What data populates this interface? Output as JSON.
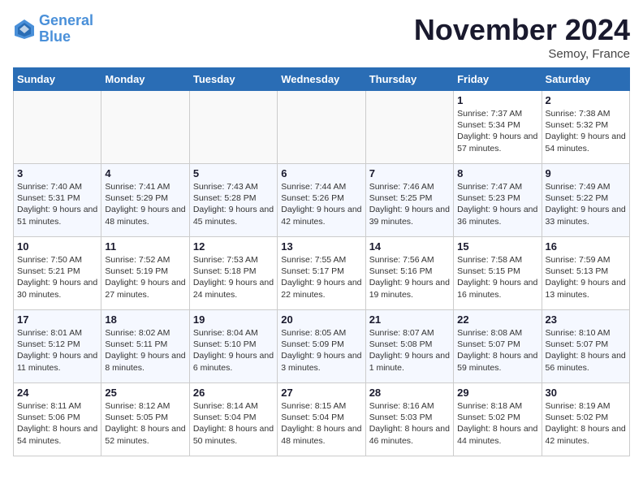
{
  "logo": {
    "line1": "General",
    "line2": "Blue"
  },
  "title": "November 2024",
  "location": "Semoy, France",
  "days_header": [
    "Sunday",
    "Monday",
    "Tuesday",
    "Wednesday",
    "Thursday",
    "Friday",
    "Saturday"
  ],
  "weeks": [
    [
      {
        "num": "",
        "info": ""
      },
      {
        "num": "",
        "info": ""
      },
      {
        "num": "",
        "info": ""
      },
      {
        "num": "",
        "info": ""
      },
      {
        "num": "",
        "info": ""
      },
      {
        "num": "1",
        "info": "Sunrise: 7:37 AM\nSunset: 5:34 PM\nDaylight: 9 hours and 57 minutes."
      },
      {
        "num": "2",
        "info": "Sunrise: 7:38 AM\nSunset: 5:32 PM\nDaylight: 9 hours and 54 minutes."
      }
    ],
    [
      {
        "num": "3",
        "info": "Sunrise: 7:40 AM\nSunset: 5:31 PM\nDaylight: 9 hours and 51 minutes."
      },
      {
        "num": "4",
        "info": "Sunrise: 7:41 AM\nSunset: 5:29 PM\nDaylight: 9 hours and 48 minutes."
      },
      {
        "num": "5",
        "info": "Sunrise: 7:43 AM\nSunset: 5:28 PM\nDaylight: 9 hours and 45 minutes."
      },
      {
        "num": "6",
        "info": "Sunrise: 7:44 AM\nSunset: 5:26 PM\nDaylight: 9 hours and 42 minutes."
      },
      {
        "num": "7",
        "info": "Sunrise: 7:46 AM\nSunset: 5:25 PM\nDaylight: 9 hours and 39 minutes."
      },
      {
        "num": "8",
        "info": "Sunrise: 7:47 AM\nSunset: 5:23 PM\nDaylight: 9 hours and 36 minutes."
      },
      {
        "num": "9",
        "info": "Sunrise: 7:49 AM\nSunset: 5:22 PM\nDaylight: 9 hours and 33 minutes."
      }
    ],
    [
      {
        "num": "10",
        "info": "Sunrise: 7:50 AM\nSunset: 5:21 PM\nDaylight: 9 hours and 30 minutes."
      },
      {
        "num": "11",
        "info": "Sunrise: 7:52 AM\nSunset: 5:19 PM\nDaylight: 9 hours and 27 minutes."
      },
      {
        "num": "12",
        "info": "Sunrise: 7:53 AM\nSunset: 5:18 PM\nDaylight: 9 hours and 24 minutes."
      },
      {
        "num": "13",
        "info": "Sunrise: 7:55 AM\nSunset: 5:17 PM\nDaylight: 9 hours and 22 minutes."
      },
      {
        "num": "14",
        "info": "Sunrise: 7:56 AM\nSunset: 5:16 PM\nDaylight: 9 hours and 19 minutes."
      },
      {
        "num": "15",
        "info": "Sunrise: 7:58 AM\nSunset: 5:15 PM\nDaylight: 9 hours and 16 minutes."
      },
      {
        "num": "16",
        "info": "Sunrise: 7:59 AM\nSunset: 5:13 PM\nDaylight: 9 hours and 13 minutes."
      }
    ],
    [
      {
        "num": "17",
        "info": "Sunrise: 8:01 AM\nSunset: 5:12 PM\nDaylight: 9 hours and 11 minutes."
      },
      {
        "num": "18",
        "info": "Sunrise: 8:02 AM\nSunset: 5:11 PM\nDaylight: 9 hours and 8 minutes."
      },
      {
        "num": "19",
        "info": "Sunrise: 8:04 AM\nSunset: 5:10 PM\nDaylight: 9 hours and 6 minutes."
      },
      {
        "num": "20",
        "info": "Sunrise: 8:05 AM\nSunset: 5:09 PM\nDaylight: 9 hours and 3 minutes."
      },
      {
        "num": "21",
        "info": "Sunrise: 8:07 AM\nSunset: 5:08 PM\nDaylight: 9 hours and 1 minute."
      },
      {
        "num": "22",
        "info": "Sunrise: 8:08 AM\nSunset: 5:07 PM\nDaylight: 8 hours and 59 minutes."
      },
      {
        "num": "23",
        "info": "Sunrise: 8:10 AM\nSunset: 5:07 PM\nDaylight: 8 hours and 56 minutes."
      }
    ],
    [
      {
        "num": "24",
        "info": "Sunrise: 8:11 AM\nSunset: 5:06 PM\nDaylight: 8 hours and 54 minutes."
      },
      {
        "num": "25",
        "info": "Sunrise: 8:12 AM\nSunset: 5:05 PM\nDaylight: 8 hours and 52 minutes."
      },
      {
        "num": "26",
        "info": "Sunrise: 8:14 AM\nSunset: 5:04 PM\nDaylight: 8 hours and 50 minutes."
      },
      {
        "num": "27",
        "info": "Sunrise: 8:15 AM\nSunset: 5:04 PM\nDaylight: 8 hours and 48 minutes."
      },
      {
        "num": "28",
        "info": "Sunrise: 8:16 AM\nSunset: 5:03 PM\nDaylight: 8 hours and 46 minutes."
      },
      {
        "num": "29",
        "info": "Sunrise: 8:18 AM\nSunset: 5:02 PM\nDaylight: 8 hours and 44 minutes."
      },
      {
        "num": "30",
        "info": "Sunrise: 8:19 AM\nSunset: 5:02 PM\nDaylight: 8 hours and 42 minutes."
      }
    ]
  ]
}
